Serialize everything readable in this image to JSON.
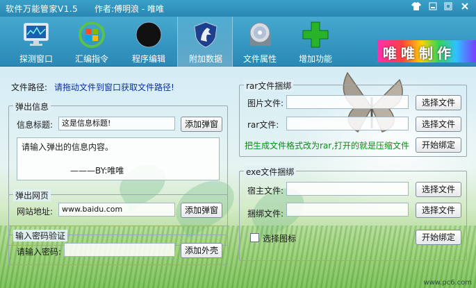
{
  "window": {
    "title": "软件万能管家V1.5",
    "author": "作者:傅明浪 - 唯唯",
    "controls": [
      "shirt-icon",
      "minimize-icon",
      "maximize-icon",
      "close-icon"
    ]
  },
  "toolbar": {
    "items": [
      {
        "label": "探测窗口",
        "icon": "monitor-icon"
      },
      {
        "label": "汇编指令",
        "icon": "windows-refresh-icon"
      },
      {
        "label": "程序编辑",
        "icon": "black-circle-icon"
      },
      {
        "label": "附加数据",
        "icon": "shield-horse-icon"
      },
      {
        "label": "文件属性",
        "icon": "disc-icon"
      },
      {
        "label": "增加功能",
        "icon": "plus-icon"
      }
    ],
    "active_index": 3,
    "brand": "唯唯制作"
  },
  "file_path": {
    "label": "文件路径:",
    "hint": "请拖动文件到窗口获取文件路径!"
  },
  "popup_info": {
    "title": "弹出信息",
    "label": "信息标题:",
    "value": "这是信息标题!",
    "button": "添加弹窗",
    "content_line1": "请输入弹出的信息内容。",
    "content_line2": "———BY:唯唯"
  },
  "popup_web": {
    "title": "弹出网页",
    "label": "网站地址:",
    "value": "www.baidu.com",
    "button": "添加弹窗"
  },
  "password": {
    "title": "输入密码验证",
    "label": "请输入密码:",
    "value": "",
    "button": "添加外壳"
  },
  "rar_bind": {
    "title": "rar文件捆绑",
    "image_label": "图片文件:",
    "image_value": "",
    "image_button": "选择文件",
    "rar_label": "rar文件:",
    "rar_value": "",
    "rar_button": "选择文件",
    "hint": "把生成文件格式改为rar,打开的就是压缩文件",
    "start_button": "开始绑定"
  },
  "exe_bind": {
    "title": "exe文件捆绑",
    "host_label": "宿主文件:",
    "host_value": "",
    "host_button": "选择文件",
    "bind_label": "捆绑文件:",
    "bind_value": "",
    "bind_button": "选择文件",
    "icon_checkbox_label": "选择图标",
    "icon_checkbox_checked": false,
    "start_button": "开始绑定"
  },
  "watermark": "www.pc6.com"
}
